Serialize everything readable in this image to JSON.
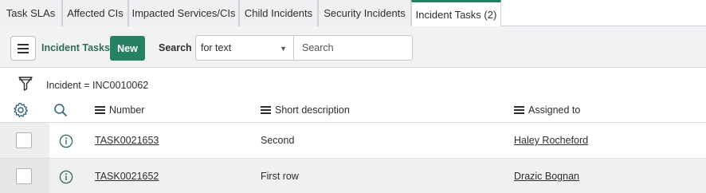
{
  "tabs": [
    {
      "label": "Task SLAs",
      "active": false
    },
    {
      "label": "Affected CIs",
      "active": false
    },
    {
      "label": "Impacted Services/CIs",
      "active": false
    },
    {
      "label": "Child Incidents",
      "active": false
    },
    {
      "label": "Security Incidents",
      "active": false
    },
    {
      "label": "Incident Tasks (2)",
      "active": true
    }
  ],
  "toolbar": {
    "title": "Incident Tasks",
    "new_label": "New",
    "search_label": "Search",
    "search_field_selected": "for text",
    "search_placeholder": "Search"
  },
  "filter": {
    "breadcrumb": "Incident = INC0010062"
  },
  "columns": [
    "Number",
    "Short description",
    "Assigned to"
  ],
  "rows": [
    {
      "number": "TASK0021653",
      "short_description": "Second",
      "assigned_to": "Haley Rocheford"
    },
    {
      "number": "TASK0021652",
      "short_description": "First row",
      "assigned_to": "Drazic Bognan"
    }
  ],
  "colors": {
    "accent": "#278062",
    "title_text": "#2c6e5a",
    "toolbar_bg": "#f1f2f3"
  },
  "icons": [
    "menu-icon",
    "dropdown-arrow-icon",
    "filter-icon",
    "gear-icon",
    "search-icon",
    "list-column-icon",
    "info-icon"
  ]
}
